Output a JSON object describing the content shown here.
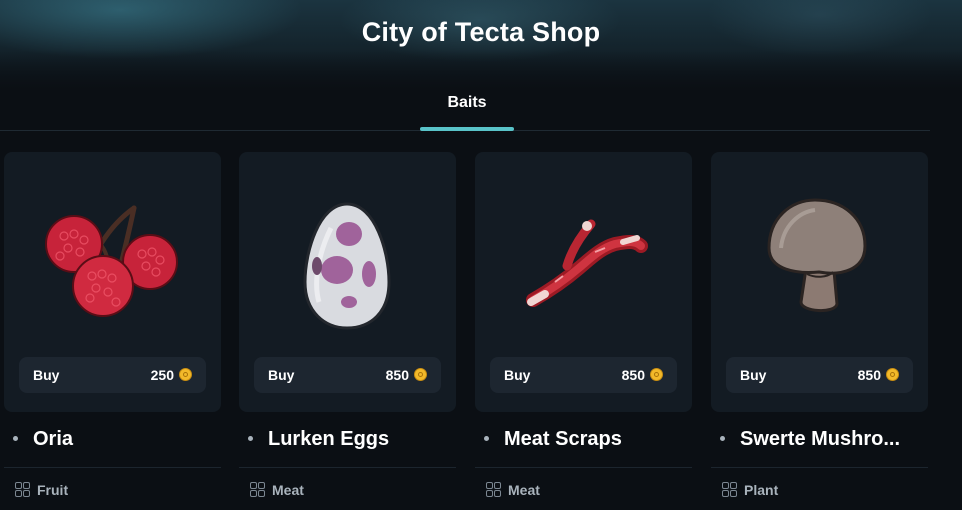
{
  "shop": {
    "title": "City of Tecta Shop"
  },
  "tabs": [
    {
      "label": "Baits",
      "active": true
    }
  ],
  "colors": {
    "accent": "#59c3c9",
    "card": "#131b23",
    "coin": "#f2b92a"
  },
  "items": [
    {
      "name": "Oria",
      "buy_label": "Buy",
      "price": "250",
      "category": "Fruit",
      "icon": "berry-cluster-icon"
    },
    {
      "name": "Lurken Eggs",
      "buy_label": "Buy",
      "price": "850",
      "category": "Meat",
      "icon": "spotted-egg-icon"
    },
    {
      "name": "Meat Scraps",
      "buy_label": "Buy",
      "price": "850",
      "category": "Meat",
      "icon": "meat-scraps-icon"
    },
    {
      "name": "Swerte Mushro...",
      "buy_label": "Buy",
      "price": "850",
      "category": "Plant",
      "icon": "mushroom-icon"
    }
  ]
}
